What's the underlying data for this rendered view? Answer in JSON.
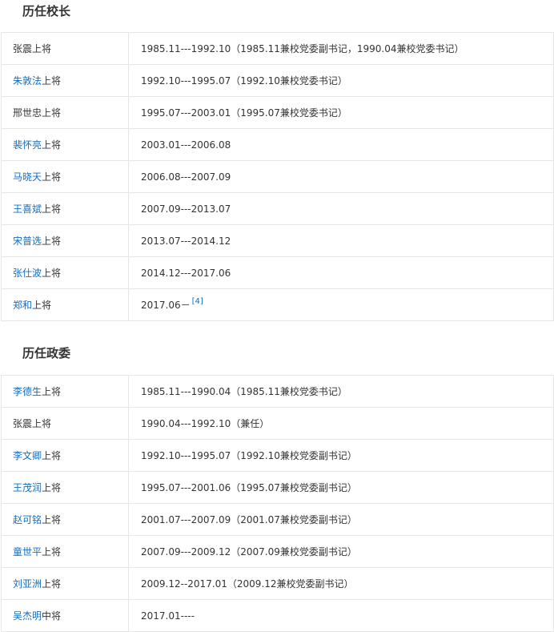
{
  "presidents": {
    "title": "历任校长",
    "rows": [
      {
        "name": "张震",
        "linked": false,
        "rank": "上将",
        "term": "1985.11---1992.10（1985.11兼校党委副书记，1990.04兼校党委书记）",
        "ref": ""
      },
      {
        "name": "朱敦法",
        "linked": true,
        "rank": "上将",
        "term": "1992.10---1995.07（1992.10兼校党委书记）",
        "ref": ""
      },
      {
        "name": "邢世忠",
        "linked": false,
        "rank": "上将",
        "term": "1995.07---2003.01（1995.07兼校党委书记）",
        "ref": ""
      },
      {
        "name": "裴怀亮",
        "linked": true,
        "rank": "上将",
        "term": "2003.01---2006.08",
        "ref": ""
      },
      {
        "name": "马晓天",
        "linked": true,
        "rank": "上将",
        "term": "2006.08---2007.09",
        "ref": ""
      },
      {
        "name": "王喜斌",
        "linked": true,
        "rank": "上将",
        "term": "2007.09---2013.07",
        "ref": ""
      },
      {
        "name": "宋普选",
        "linked": true,
        "rank": "上将",
        "term": "2013.07---2014.12",
        "ref": ""
      },
      {
        "name": "张仕波",
        "linked": true,
        "rank": "上将",
        "term": "2014.12---2017.06",
        "ref": ""
      },
      {
        "name": "郑和",
        "linked": true,
        "rank": "上将",
        "term": "2017.06－",
        "ref": "[4]"
      }
    ]
  },
  "commissars": {
    "title": "历任政委",
    "rows": [
      {
        "name": "李德生",
        "linked": true,
        "rank": "上将",
        "term": "1985.11---1990.04（1985.11兼校党委书记）",
        "ref": ""
      },
      {
        "name": "张震",
        "linked": false,
        "rank": "上将",
        "term": "1990.04---1992.10（兼任）",
        "ref": ""
      },
      {
        "name": "李文卿",
        "linked": true,
        "rank": "上将",
        "term": "1992.10---1995.07（1992.10兼校党委副书记）",
        "ref": ""
      },
      {
        "name": "王茂润",
        "linked": true,
        "rank": "上将",
        "term": "1995.07---2001.06（1995.07兼校党委副书记）",
        "ref": ""
      },
      {
        "name": "赵可铭",
        "linked": true,
        "rank": "上将",
        "term": "2001.07---2007.09（2001.07兼校党委副书记）",
        "ref": ""
      },
      {
        "name": "童世平",
        "linked": true,
        "rank": "上将",
        "term": "2007.09---2009.12（2007.09兼校党委副书记）",
        "ref": ""
      },
      {
        "name": "刘亚洲",
        "linked": true,
        "rank": "上将",
        "term": "2009.12--2017.01（2009.12兼校党委副书记）",
        "ref": ""
      },
      {
        "name": "吴杰明",
        "linked": true,
        "rank": "中将",
        "term": "2017.01----",
        "ref": ""
      }
    ]
  },
  "colors": {
    "link": "#136ec2",
    "text": "#333333",
    "border": "#e6e6e6"
  }
}
